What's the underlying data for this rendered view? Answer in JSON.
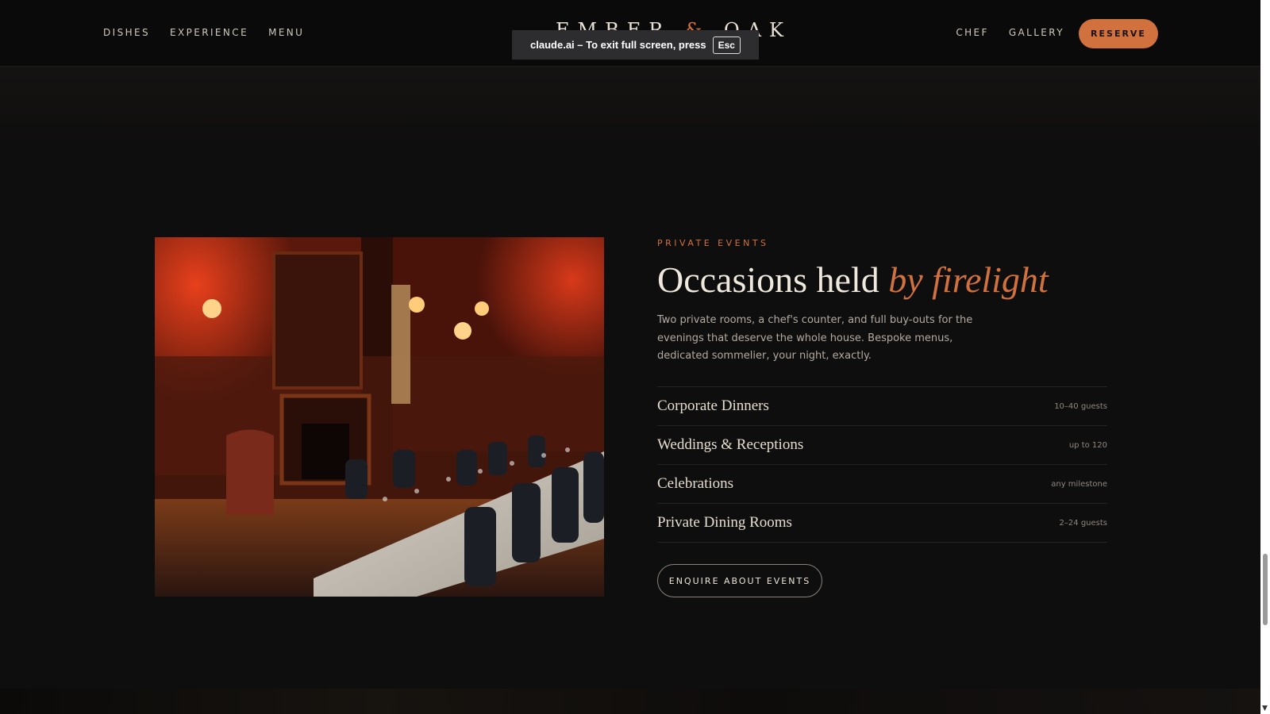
{
  "header": {
    "nav_left": [
      "DISHES",
      "EXPERIENCE",
      "MENU"
    ],
    "nav_right": [
      "CHEF",
      "GALLERY"
    ],
    "logo_left": "EMBER",
    "logo_amp": "&",
    "logo_right": "OAK",
    "reserve_label": "RESERVE",
    "scroll_progress_pct": 86
  },
  "fullscreen_toast": {
    "text": "claude.ai – To exit full screen, press",
    "key": "Esc"
  },
  "events_section": {
    "eyebrow": "PRIVATE EVENTS",
    "headline": "Occasions held",
    "headline_accent": "by firelight",
    "description": "Two private rooms, a chef's counter, and full buy-outs for the evenings that deserve the whole house. Bespoke menus, dedicated sommelier, your night, exactly.",
    "items": [
      {
        "name": "Corporate Dinners",
        "meta": "10–40 guests"
      },
      {
        "name": "Weddings & Receptions",
        "meta": "up to 120"
      },
      {
        "name": "Celebrations",
        "meta": "any milestone"
      },
      {
        "name": "Private Dining Rooms",
        "meta": "2–24 guests"
      }
    ],
    "cta_label": "ENQUIRE ABOUT EVENTS"
  },
  "colors": {
    "accent": "#d1713d",
    "background": "#0f0e0e",
    "text": "#e9e1d6"
  }
}
